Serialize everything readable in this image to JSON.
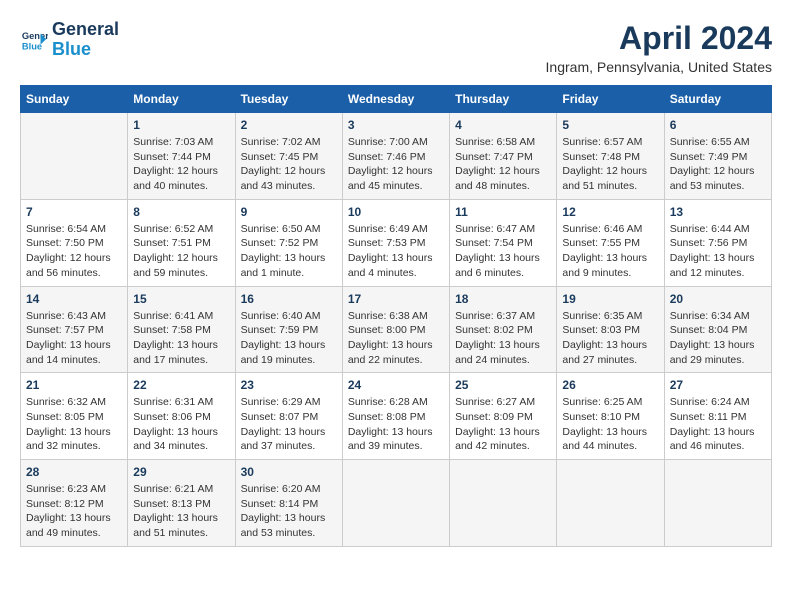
{
  "logo": {
    "line1": "General",
    "line2": "Blue"
  },
  "title": "April 2024",
  "subtitle": "Ingram, Pennsylvania, United States",
  "headers": [
    "Sunday",
    "Monday",
    "Tuesday",
    "Wednesday",
    "Thursday",
    "Friday",
    "Saturday"
  ],
  "weeks": [
    [
      {
        "day": "",
        "info": ""
      },
      {
        "day": "1",
        "info": "Sunrise: 7:03 AM\nSunset: 7:44 PM\nDaylight: 12 hours\nand 40 minutes."
      },
      {
        "day": "2",
        "info": "Sunrise: 7:02 AM\nSunset: 7:45 PM\nDaylight: 12 hours\nand 43 minutes."
      },
      {
        "day": "3",
        "info": "Sunrise: 7:00 AM\nSunset: 7:46 PM\nDaylight: 12 hours\nand 45 minutes."
      },
      {
        "day": "4",
        "info": "Sunrise: 6:58 AM\nSunset: 7:47 PM\nDaylight: 12 hours\nand 48 minutes."
      },
      {
        "day": "5",
        "info": "Sunrise: 6:57 AM\nSunset: 7:48 PM\nDaylight: 12 hours\nand 51 minutes."
      },
      {
        "day": "6",
        "info": "Sunrise: 6:55 AM\nSunset: 7:49 PM\nDaylight: 12 hours\nand 53 minutes."
      }
    ],
    [
      {
        "day": "7",
        "info": "Sunrise: 6:54 AM\nSunset: 7:50 PM\nDaylight: 12 hours\nand 56 minutes."
      },
      {
        "day": "8",
        "info": "Sunrise: 6:52 AM\nSunset: 7:51 PM\nDaylight: 12 hours\nand 59 minutes."
      },
      {
        "day": "9",
        "info": "Sunrise: 6:50 AM\nSunset: 7:52 PM\nDaylight: 13 hours\nand 1 minute."
      },
      {
        "day": "10",
        "info": "Sunrise: 6:49 AM\nSunset: 7:53 PM\nDaylight: 13 hours\nand 4 minutes."
      },
      {
        "day": "11",
        "info": "Sunrise: 6:47 AM\nSunset: 7:54 PM\nDaylight: 13 hours\nand 6 minutes."
      },
      {
        "day": "12",
        "info": "Sunrise: 6:46 AM\nSunset: 7:55 PM\nDaylight: 13 hours\nand 9 minutes."
      },
      {
        "day": "13",
        "info": "Sunrise: 6:44 AM\nSunset: 7:56 PM\nDaylight: 13 hours\nand 12 minutes."
      }
    ],
    [
      {
        "day": "14",
        "info": "Sunrise: 6:43 AM\nSunset: 7:57 PM\nDaylight: 13 hours\nand 14 minutes."
      },
      {
        "day": "15",
        "info": "Sunrise: 6:41 AM\nSunset: 7:58 PM\nDaylight: 13 hours\nand 17 minutes."
      },
      {
        "day": "16",
        "info": "Sunrise: 6:40 AM\nSunset: 7:59 PM\nDaylight: 13 hours\nand 19 minutes."
      },
      {
        "day": "17",
        "info": "Sunrise: 6:38 AM\nSunset: 8:00 PM\nDaylight: 13 hours\nand 22 minutes."
      },
      {
        "day": "18",
        "info": "Sunrise: 6:37 AM\nSunset: 8:02 PM\nDaylight: 13 hours\nand 24 minutes."
      },
      {
        "day": "19",
        "info": "Sunrise: 6:35 AM\nSunset: 8:03 PM\nDaylight: 13 hours\nand 27 minutes."
      },
      {
        "day": "20",
        "info": "Sunrise: 6:34 AM\nSunset: 8:04 PM\nDaylight: 13 hours\nand 29 minutes."
      }
    ],
    [
      {
        "day": "21",
        "info": "Sunrise: 6:32 AM\nSunset: 8:05 PM\nDaylight: 13 hours\nand 32 minutes."
      },
      {
        "day": "22",
        "info": "Sunrise: 6:31 AM\nSunset: 8:06 PM\nDaylight: 13 hours\nand 34 minutes."
      },
      {
        "day": "23",
        "info": "Sunrise: 6:29 AM\nSunset: 8:07 PM\nDaylight: 13 hours\nand 37 minutes."
      },
      {
        "day": "24",
        "info": "Sunrise: 6:28 AM\nSunset: 8:08 PM\nDaylight: 13 hours\nand 39 minutes."
      },
      {
        "day": "25",
        "info": "Sunrise: 6:27 AM\nSunset: 8:09 PM\nDaylight: 13 hours\nand 42 minutes."
      },
      {
        "day": "26",
        "info": "Sunrise: 6:25 AM\nSunset: 8:10 PM\nDaylight: 13 hours\nand 44 minutes."
      },
      {
        "day": "27",
        "info": "Sunrise: 6:24 AM\nSunset: 8:11 PM\nDaylight: 13 hours\nand 46 minutes."
      }
    ],
    [
      {
        "day": "28",
        "info": "Sunrise: 6:23 AM\nSunset: 8:12 PM\nDaylight: 13 hours\nand 49 minutes."
      },
      {
        "day": "29",
        "info": "Sunrise: 6:21 AM\nSunset: 8:13 PM\nDaylight: 13 hours\nand 51 minutes."
      },
      {
        "day": "30",
        "info": "Sunrise: 6:20 AM\nSunset: 8:14 PM\nDaylight: 13 hours\nand 53 minutes."
      },
      {
        "day": "",
        "info": ""
      },
      {
        "day": "",
        "info": ""
      },
      {
        "day": "",
        "info": ""
      },
      {
        "day": "",
        "info": ""
      }
    ]
  ]
}
